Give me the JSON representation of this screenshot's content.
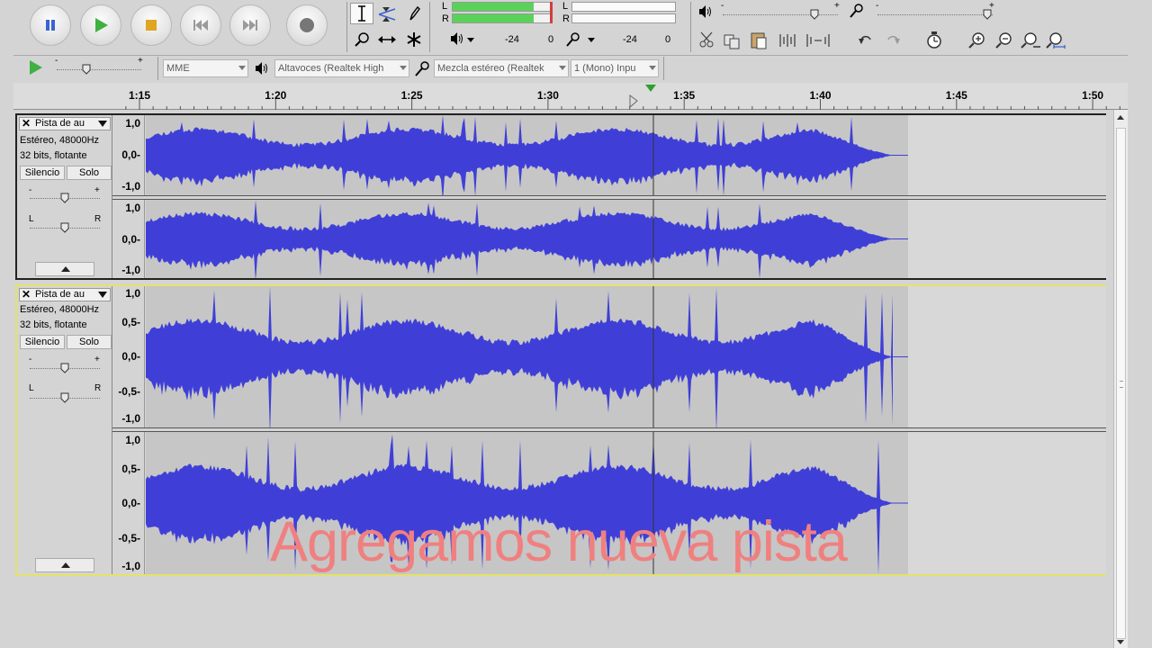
{
  "transport": {
    "buttons": [
      "pause",
      "play",
      "stop",
      "skip-to-start",
      "skip-to-end",
      "record"
    ],
    "colors": {
      "pause": "#3b63d1",
      "play": "#3fb042",
      "stop": "#e0a522",
      "record": "#777777",
      "skip": "#9a9a9a"
    }
  },
  "meters": {
    "playback_channels": [
      "L",
      "R"
    ],
    "record_channels": [
      "L",
      "R"
    ],
    "playback_scale": [
      "-24",
      "0"
    ],
    "record_scale": [
      "-24",
      "0"
    ],
    "playback_level_fill": 0.82,
    "meter_green": "#5ad25a"
  },
  "mixer": {
    "output_slider_symbols": [
      "-",
      "+"
    ],
    "input_slider_symbols": [
      "-",
      "+"
    ],
    "output_level": 0.8,
    "input_level": 0.95
  },
  "devicebar": {
    "play_at_speed_symbols": [
      "-",
      "+"
    ],
    "play_speed_level": 0.35,
    "host": "MME",
    "output_device": "Altavoces (Realtek High",
    "input_device": "Mezcla estéreo (Realtek",
    "input_channels": "1 (Mono) Inpu"
  },
  "timeline": {
    "labels": [
      "1:15",
      "1:20",
      "1:25",
      "1:30",
      "1:35",
      "1:40",
      "1:45",
      "1:50"
    ],
    "playhead": "1:34"
  },
  "tracks": [
    {
      "name": "Pista de au",
      "close": "✕",
      "rate": "Estéreo, 48000Hz",
      "format": "32 bits, flotante",
      "mute": "Silencio",
      "solo": "Solo",
      "gain_symbols": [
        "-",
        "+"
      ],
      "pan_symbols": [
        "L",
        "R"
      ],
      "ch1_scale": [
        "1,0",
        "0,0-",
        "-1,0"
      ],
      "ch2_scale": [
        "1,0",
        "0,0-",
        "-1,0"
      ]
    },
    {
      "name": "Pista de au",
      "close": "✕",
      "rate": "Estéreo, 48000Hz",
      "format": "32 bits, flotante",
      "mute": "Silencio",
      "solo": "Solo",
      "gain_symbols": [
        "-",
        "+"
      ],
      "pan_symbols": [
        "L",
        "R"
      ],
      "ch1_scale": [
        "1,0",
        "0,5-",
        "0,0-",
        "-0,5-",
        "-1,0"
      ],
      "ch2_scale": [
        "1,0",
        "0,5-",
        "0,0-",
        "-0,5-",
        "-1,0"
      ]
    }
  ],
  "waveform_color": "#3f3fd8",
  "selection_color": "#e3e36a",
  "caption": "Agregamos nueva pista"
}
